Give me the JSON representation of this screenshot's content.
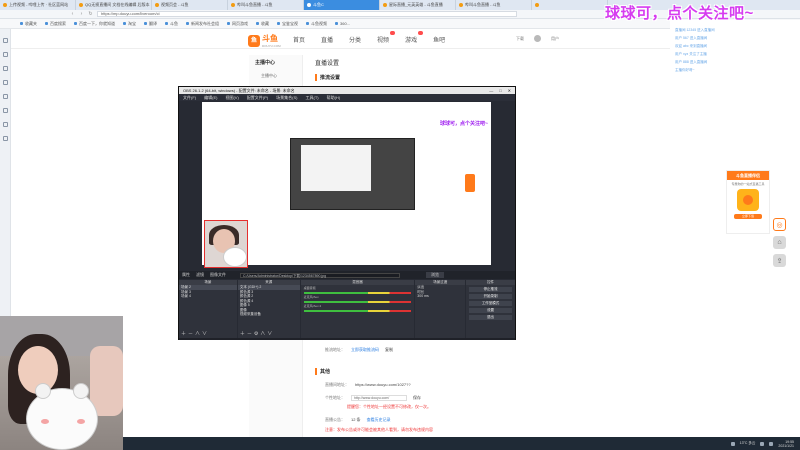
{
  "browser": {
    "tabs": [
      {
        "label": "上传视频 - 哔哩上传 · 社区蓝网站",
        "active": false
      },
      {
        "label": "QQ无损直播间 文档在线编辑 后版本",
        "active": false
      },
      {
        "label": "视频页会 - 斗鱼",
        "active": false
      },
      {
        "label": "哔叫斗鱼直播 - 斗鱼",
        "active": false
      },
      {
        "label": "斗鱼C",
        "active": true
      },
      {
        "label": "星际直播_元英英雄 - 斗鱼直播",
        "active": false
      },
      {
        "label": "哔叫斗鱼直播 - 斗鱼",
        "active": false
      },
      {
        "label": "",
        "active": false
      }
    ],
    "url": "https://mp.douyu.com/liveroom/ci",
    "bookmarks": [
      "收藏夹",
      "百度搜索",
      "百度一下，你就知道",
      "淘宝",
      "翻译",
      "斗鱼",
      "新闻发布社会组",
      "网页游戏",
      "收藏",
      "宝鉴宝视",
      "斗鱼视频",
      "360..."
    ]
  },
  "site": {
    "logo": "斗鱼",
    "logo_sub": "DOUYU.COM",
    "nav": [
      {
        "label": "首页",
        "hot": false,
        "badge": false
      },
      {
        "label": "直播",
        "hot": false,
        "badge": false
      },
      {
        "label": "分类",
        "hot": false,
        "badge": false
      },
      {
        "label": "视频",
        "hot": false,
        "badge": true
      },
      {
        "label": "游戏",
        "hot": false,
        "badge": true
      },
      {
        "label": "鱼吧",
        "hot": false,
        "badge": false
      }
    ],
    "header_right": [
      "下载",
      "用户"
    ]
  },
  "sidemenu": {
    "title": "主播中心",
    "items": [
      "主播中心"
    ]
  },
  "content": {
    "title": "直播设置",
    "section": "推流设置",
    "rows": [
      {
        "label": "推流地址：",
        "value": "立即获取推流码",
        "kind": "link",
        "extra": "复制"
      }
    ],
    "section2": "其他",
    "rows2": [
      {
        "label": "直播间地址：",
        "value": "https://www.douyu.com/1027??",
        "kind": "plain"
      },
      {
        "label": "个性地址：",
        "value": "http://www.douyu.com/",
        "kind": "input",
        "extra": "保存"
      },
      {
        "label": "",
        "value": "提醒您：个性地址一经设置不可修改，仅一次。",
        "kind": "warn"
      },
      {
        "label": "直播公告：",
        "value": "12 条",
        "kind": "plain",
        "extra": "查看历史记录"
      },
      {
        "label": "",
        "value": "注意：发布公告或许可能会被其他人看到，请勿发布违规内容",
        "kind": "warn"
      }
    ]
  },
  "obs": {
    "title": "OBS 26.1.2 (64-bit, windows) - 配置文件: 未命名 - 场景: 未命名",
    "menu": [
      "文件(F)",
      "编辑(E)",
      "视图(V)",
      "配置文件(P)",
      "场景集合(S)",
      "工具(T)",
      "帮助(H)"
    ],
    "overlay_text": "球球可，点个关注吧~",
    "bar": {
      "prop": "属性",
      "filter": "滤镜",
      "file_label": "图像文件",
      "path": "C:/Users/Administrator/Desktop/下载/1234567890.jpg",
      "browse": "浏览"
    },
    "docks": {
      "scenes": {
        "header": "场景",
        "items": [
          "场景 2",
          "场景 3",
          "场景 4"
        ]
      },
      "sources": {
        "header": "来源",
        "items": [
          "文本 (GDI+) 2",
          "颜色源 3",
          "颜色源 2",
          "颜色源 4",
          "图像 5",
          "图像",
          "视频采集设备"
        ]
      },
      "mixer": {
        "header": "混音器",
        "channels": [
          "桌面音频",
          "麦克风/Aux",
          "麦克风/Aux 2"
        ]
      },
      "transitions": {
        "header": "场景过渡",
        "type": "淡出",
        "duration_label": "时长",
        "duration": "300 ms"
      },
      "controls": {
        "header": "控件",
        "buttons": [
          "停止推流",
          "开始录制",
          "工作室模式",
          "设置",
          "退出"
        ]
      }
    }
  },
  "stream": {
    "danmaku": "球球可，点个关注吧~",
    "chat": [
      "直播间 12345 进入直播间",
      "用户 567 进入直播间",
      "欢迎 abc 来到直播间",
      "用户 xyz 关注了主播",
      "用户 888 进入直播间",
      "主播你好呀~"
    ],
    "promo": {
      "title": "斗鱼直播伴侣",
      "line1": "专属你的一站式直播工具",
      "btn": "立即下载"
    }
  },
  "taskbar": {
    "weather": "13°C 多云",
    "time": "19:55",
    "date": "2021/1/21"
  },
  "colors": {
    "brand": "#ff7a1a",
    "danmaku": "#d63cf0",
    "obs_bg": "#272a33"
  }
}
